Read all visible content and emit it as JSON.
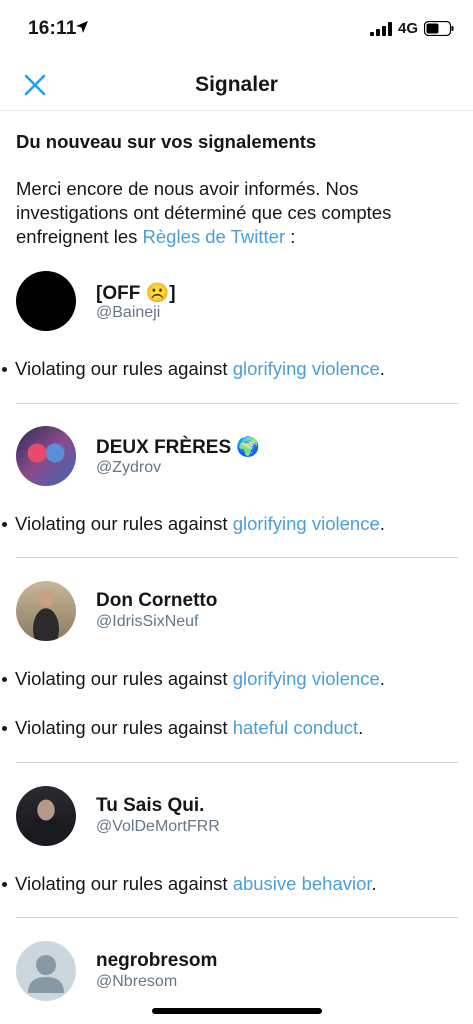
{
  "status_bar": {
    "time": "16:11",
    "network": "4G"
  },
  "nav": {
    "title": "Signaler",
    "close_icon": "close-icon"
  },
  "heading": "Du nouveau sur vos signalements",
  "intro": {
    "text_before": "Merci encore de nous avoir informés. Nos investigations ont déterminé que ces comptes enfreignent les ",
    "link": "Règles de Twitter",
    "text_after": " :"
  },
  "violation_prefix": "Violating our rules against ",
  "accounts": [
    {
      "name": "[OFF ☹️]",
      "handle": "@Baineji",
      "violations": [
        {
          "link": "glorifying violence",
          "suffix": "."
        }
      ]
    },
    {
      "name": "DEUX FRÈRES 🌍",
      "handle": "@Zydrov",
      "violations": [
        {
          "link": "glorifying violence",
          "suffix": "."
        }
      ]
    },
    {
      "name": "Don Cornetto",
      "handle": "@IdrisSixNeuf",
      "violations": [
        {
          "link": "glorifying violence",
          "suffix": "."
        },
        {
          "link": "hateful conduct",
          "suffix": "."
        }
      ]
    },
    {
      "name": "Tu Sais Qui.",
      "handle": "@VolDeMortFRR",
      "violations": [
        {
          "link": "abusive behavior",
          "suffix": "."
        }
      ]
    },
    {
      "name": "negrobresom",
      "handle": "@Nbresom",
      "violations": []
    }
  ],
  "colors": {
    "link": "#4a9fd8",
    "accent": "#1da1f2",
    "handle": "#657786",
    "divider": "#ccd6dd"
  }
}
